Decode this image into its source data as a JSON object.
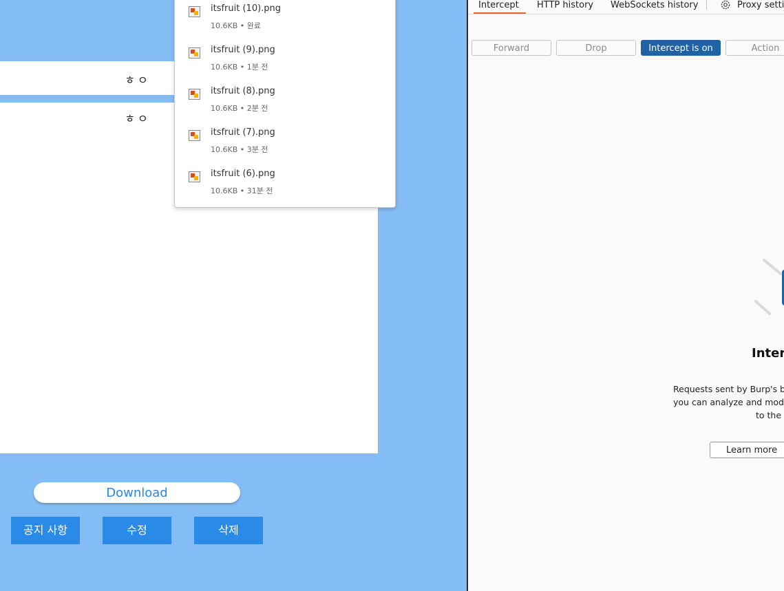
{
  "page": {
    "rows": [
      {
        "text": "ㅎㅇ"
      },
      {
        "text": "ㅎㅇ"
      }
    ],
    "download_label": "Download",
    "buttons": {
      "notice": "공지 사항",
      "edit": "수정",
      "delete": "삭제"
    }
  },
  "downloads": [
    {
      "name": "itsfruit (10).png",
      "size": "10.6KB",
      "status": "완료"
    },
    {
      "name": "itsfruit (9).png",
      "size": "10.6KB",
      "status": "1분 전"
    },
    {
      "name": "itsfruit (8).png",
      "size": "10.6KB",
      "status": "2분 전"
    },
    {
      "name": "itsfruit (7).png",
      "size": "10.6KB",
      "status": "3분 전"
    },
    {
      "name": "itsfruit (6).png",
      "size": "10.6KB",
      "status": "31분 전"
    }
  ],
  "burp": {
    "tabs": [
      "Intercept",
      "HTTP history",
      "WebSockets history",
      "Proxy settin"
    ],
    "active_tab": "Intercept",
    "toolbar": {
      "forward": "Forward",
      "drop": "Drop",
      "intercept": "Intercept is on",
      "action": "Action"
    },
    "empty_state": {
      "title": "Interc",
      "line1": "Requests sent by Burp's br",
      "line2": "you can analyze and modi",
      "line3": "to the",
      "learn_more": "Learn more"
    },
    "colors": {
      "accent": "#e8662a",
      "intercept_on": "#1f63a3"
    }
  },
  "colors": {
    "page_background": "#84bdf5",
    "button_blue": "#2a8ae8"
  }
}
